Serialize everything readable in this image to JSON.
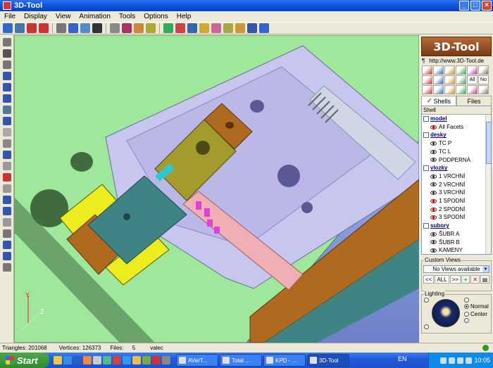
{
  "window": {
    "title": "3D-Tool",
    "minimize": "_",
    "maximize": "□",
    "close": "×"
  },
  "menu": [
    "File",
    "Display",
    "View",
    "Animation",
    "Tools",
    "Options",
    "Help"
  ],
  "toolbar_colors": [
    "#2a6cc8",
    "#4477aa",
    "#cc3333",
    "#cc3333",
    "#777777",
    "#3366cc",
    "#5588cc",
    "#333333",
    "#888888",
    "#aa3366",
    "#cc8833",
    "#aaaa33",
    "#33aa55",
    "#cc4444",
    "#3366aa",
    "#ccaa33",
    "#cc6699",
    "#aaaa44",
    "#cc9933",
    "#3355aa",
    "#3366cc"
  ],
  "left_toolbar_colors": [
    "#777",
    "#555",
    "#777",
    "#3355aa",
    "#3355aa",
    "#3355aa",
    "#557799",
    "#3355aa",
    "#aaa",
    "#888",
    "#3355aa",
    "#999",
    "#cc3333",
    "#999",
    "#3355aa",
    "#3355aa",
    "#999",
    "#777",
    "#3355aa",
    "#3355aa",
    "#777"
  ],
  "panel": {
    "logo": "3D-Tool",
    "url_left": "¶",
    "url": "http://www.3D-Tool.de",
    "icon_grid": [
      "",
      "",
      "",
      "",
      "",
      "",
      "",
      "",
      "",
      "",
      "All",
      "No",
      "",
      "",
      "",
      "",
      "",
      ""
    ],
    "tabs": {
      "shells": "Shells",
      "files": "Files",
      "shells_check": "✓"
    },
    "shell_header": "Shell",
    "tree": [
      {
        "group": "model",
        "items": [
          {
            "label": "All Facets",
            "hidden": true
          }
        ]
      },
      {
        "group": "desky",
        "items": [
          {
            "label": "TC P"
          },
          {
            "label": "TC L"
          },
          {
            "label": "PODPERNÁ"
          }
        ]
      },
      {
        "group": "vlozky",
        "items": [
          {
            "label": "1 VRCHNÍ"
          },
          {
            "label": "2 VRCHNÍ"
          },
          {
            "label": "3 VRCHNÍ"
          },
          {
            "label": "1 SPODNÍ",
            "hidden": true
          },
          {
            "label": "2 SPODNÍ",
            "hidden": true
          },
          {
            "label": "3 SPODNÍ",
            "hidden": true
          }
        ]
      },
      {
        "group": "subory",
        "items": [
          {
            "label": "ŠUBR A"
          },
          {
            "label": "ŠUBR B"
          },
          {
            "label": "KAMENY"
          }
        ]
      }
    ],
    "custom_views": {
      "label": "Custom Views",
      "selected": "No Views available",
      "buttons": [
        "<<",
        "ALL",
        ">>",
        "",
        "",
        ""
      ]
    },
    "lighting": {
      "label": "Lighting",
      "options": [
        "Normal",
        "Center"
      ],
      "selected": "Normal"
    }
  },
  "status": {
    "triangles_label": "Triangles:",
    "triangles": "201068",
    "vertices_label": "Vertices:",
    "vertices": "126373",
    "files_label": "Files:",
    "files": "5",
    "name": "valec"
  },
  "axes": {
    "y": "Y",
    "z": "Z"
  },
  "taskbar": {
    "start": "Start",
    "tasks": [
      {
        "label": "AVerT..."
      },
      {
        "label": "Total ..."
      },
      {
        "label": "KPD - ..."
      },
      {
        "label": "3D-Tool",
        "active": true
      }
    ],
    "lang": "EN",
    "clock": "10:05"
  },
  "colors": {
    "plate_green": "#9fe79a",
    "plate_lavender": "#c7c6ee",
    "teal_block": "#3e8484",
    "brown_block": "#b06a20",
    "olive_block": "#a39b2c",
    "yellow_block": "#ecec1e",
    "pink_rod": "#f0aeb5",
    "light_rod": "#cfd7e6"
  }
}
